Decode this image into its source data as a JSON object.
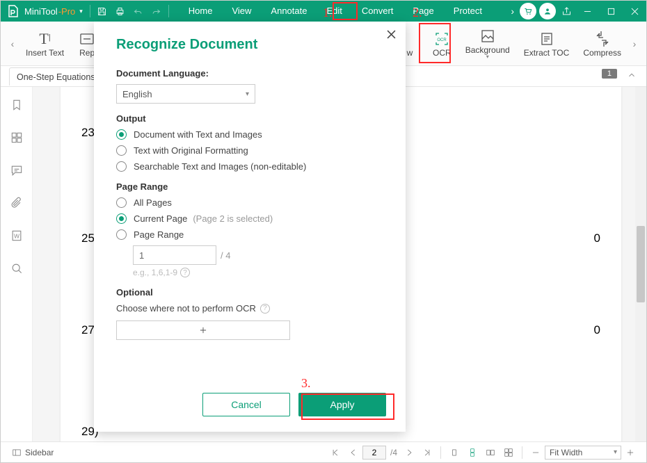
{
  "app": {
    "name_a": "MiniTool",
    "name_b": "-Pro"
  },
  "menu": [
    "Home",
    "View",
    "Annotate",
    "Edit",
    "Convert",
    "Page",
    "Protect"
  ],
  "ribbon": {
    "cursor": "I",
    "insert_text": "Insert Text",
    "rep": "Rep",
    "w_tail": "w",
    "ocr": "OCR",
    "background": "Background",
    "extract_toc": "Extract TOC",
    "compress": "Compress"
  },
  "doc_tab": "One-Step Equations",
  "page_badge": "1",
  "math_rows": [
    {
      "a": "23)",
      "b": ""
    },
    {
      "a": "25)",
      "b": "0"
    },
    {
      "a": "27)",
      "b": "0"
    },
    {
      "a": "29)",
      "b": ""
    }
  ],
  "status": {
    "sidebar": "Sidebar",
    "page_current": "2",
    "page_total": "/4",
    "fit": "Fit Width"
  },
  "dialog": {
    "title": "Recognize Document",
    "lang_label": "Document Language:",
    "lang_value": "English",
    "output_label": "Output",
    "out1": "Document with Text and Images",
    "out2": "Text with Original Formatting",
    "out3": "Searchable Text and Images (non-editable)",
    "range_label": "Page Range",
    "r1": "All Pages",
    "r2": "Current Page",
    "r2_hint": "(Page 2 is selected)",
    "r3": "Page Range",
    "range_input": "1",
    "range_total": "/ 4",
    "range_eg": "e.g., 1,6,1-9",
    "opt_label": "Optional",
    "opt_desc": "Choose where not to perform OCR",
    "cancel": "Cancel",
    "apply": "Apply"
  },
  "annot": {
    "n1": "1.",
    "n2": "2.",
    "n3": "3."
  }
}
